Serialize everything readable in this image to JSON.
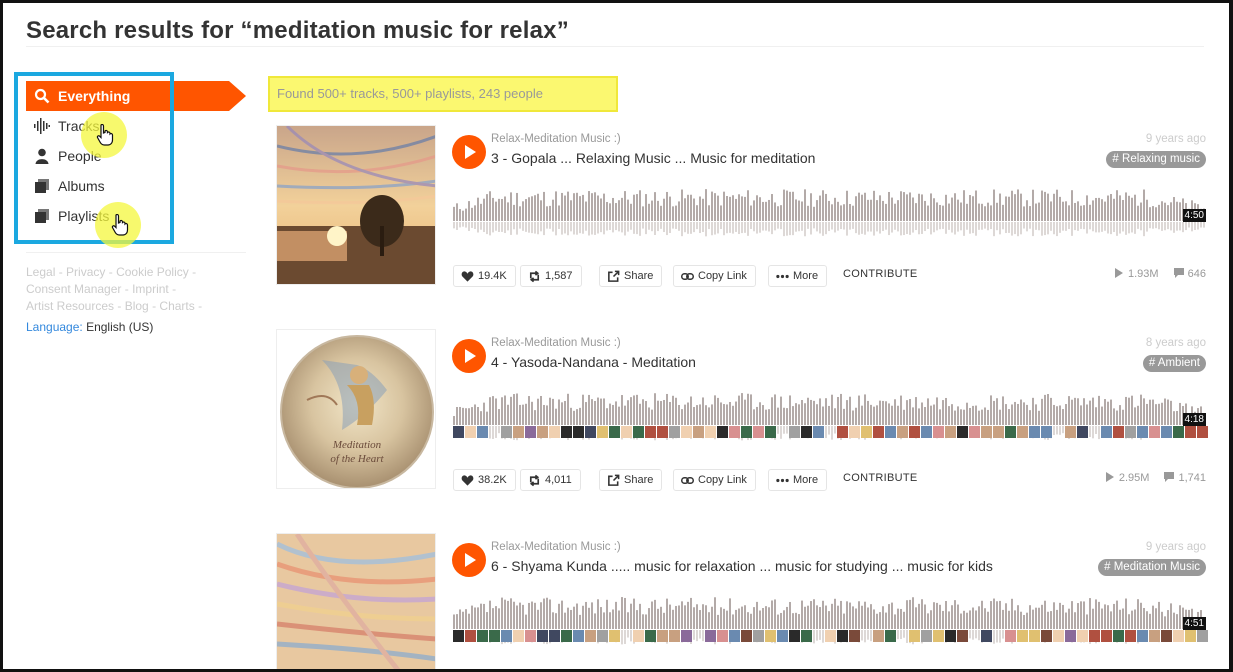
{
  "page": {
    "heading": "Search results for “meditation music for relax”",
    "found": "Found 500+ tracks, 500+ playlists, 243 people"
  },
  "filters": [
    {
      "label": "Everything",
      "icon": "search-icon",
      "active": true
    },
    {
      "label": "Tracks",
      "icon": "waveform-icon"
    },
    {
      "label": "People",
      "icon": "person-icon"
    },
    {
      "label": "Albums",
      "icon": "album-icon"
    },
    {
      "label": "Playlists",
      "icon": "playlist-icon"
    }
  ],
  "footer": {
    "links": [
      "Legal",
      "Privacy",
      "Cookie Policy",
      "Consent Manager",
      "Imprint",
      "Artist Resources",
      "Blog",
      "Charts"
    ],
    "language_label": "Language:",
    "language_value": "English (US)"
  },
  "tracks": [
    {
      "uploader": "Relax-Meditation Music :)",
      "title": "3 - Gopala ... Relaxing Music ... Music for meditation",
      "age": "9 years ago",
      "tag": "# Relaxing music",
      "duration": "4:50",
      "likes": "19.4K",
      "reposts": "1,587",
      "plays": "1.93M",
      "comments": "646",
      "has_comment_strip": false
    },
    {
      "uploader": "Relax-Meditation Music :)",
      "title": "4 - Yasoda-Nandana - Meditation",
      "age": "8 years ago",
      "tag": "# Ambient",
      "duration": "4:18",
      "likes": "38.2K",
      "reposts": "4,011",
      "plays": "2.95M",
      "comments": "1,741",
      "has_comment_strip": true,
      "art_text": "Meditation of the Heart"
    },
    {
      "uploader": "Relax-Meditation Music :)",
      "title": "6 - Shyama Kunda ..... music for relaxation ... music for studying ... music for kids",
      "age": "9 years ago",
      "tag": "# Meditation Music",
      "duration": "4:51",
      "has_comment_strip": true
    }
  ],
  "actions": {
    "share": "Share",
    "copy_link": "Copy Link",
    "more": "More",
    "contribute": "CONTRIBUTE"
  },
  "colors": {
    "accent": "#ff5500",
    "highlight_box": "#1ba8e0",
    "found_highlight": "#fbf870",
    "waveform": "#b3aaa8"
  }
}
